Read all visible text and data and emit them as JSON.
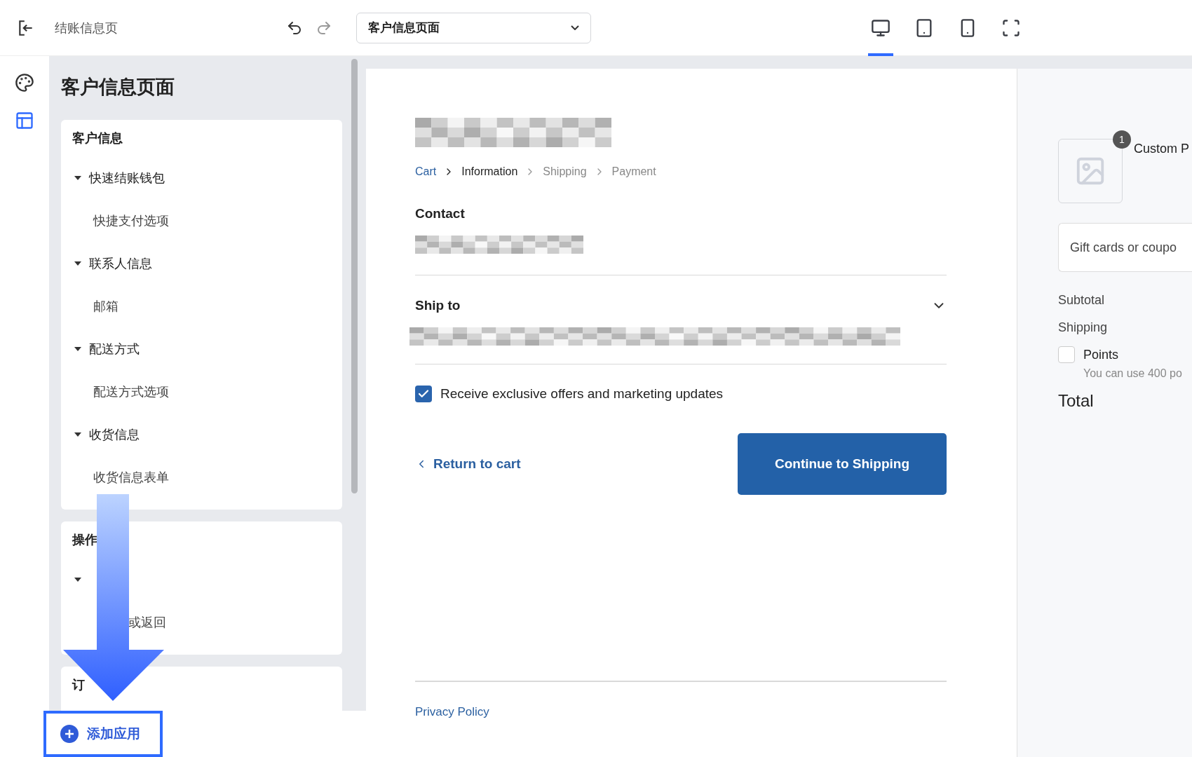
{
  "toolbar": {
    "page_title": "结账信息页",
    "page_select": {
      "value": "客户信息页面"
    },
    "devices": [
      {
        "kind": "desktop",
        "selected": true
      },
      {
        "kind": "tablet",
        "selected": false
      },
      {
        "kind": "phone",
        "selected": false
      },
      {
        "kind": "fullscreen",
        "selected": false
      }
    ]
  },
  "rail": [
    {
      "kind": "theme",
      "selected": false
    },
    {
      "kind": "sections",
      "selected": true
    }
  ],
  "sidebar": {
    "title": "客户信息页面",
    "sections": [
      {
        "title": "客户信息",
        "items": [
          {
            "label": "快速结账钱包",
            "expanded": true,
            "children": [
              {
                "label": "快捷支付选项"
              }
            ]
          },
          {
            "label": "联系人信息",
            "expanded": true,
            "children": [
              {
                "label": "邮箱"
              }
            ]
          },
          {
            "label": "配送方式",
            "expanded": true,
            "children": [
              {
                "label": "配送方式选项"
              }
            ]
          },
          {
            "label": "收货信息",
            "expanded": true,
            "children": [
              {
                "label": "收货信息表单"
              }
            ]
          }
        ]
      },
      {
        "title": "操作",
        "items": [
          {
            "expanded": true,
            "children": [
              {
                "label": "或返回"
              }
            ]
          }
        ]
      },
      {
        "title": "订"
      }
    ],
    "add_app": "添加应用"
  },
  "preview": {
    "breadcrumb": [
      {
        "label": "Cart",
        "kind": "link"
      },
      {
        "label": "Information",
        "kind": "current"
      },
      {
        "label": "Shipping",
        "kind": "upcoming"
      },
      {
        "label": "Payment",
        "kind": "upcoming"
      }
    ],
    "contact_title": "Contact",
    "ship_to_title": "Ship to",
    "marketing": {
      "label": "Receive exclusive offers and marketing updates",
      "checked": true
    },
    "return_link": "Return to cart",
    "continue_button": "Continue to Shipping",
    "privacy_link": "Privacy Policy"
  },
  "summary": {
    "product": {
      "name": "Custom P",
      "quantity": "1"
    },
    "gift": {
      "placeholder": "Gift cards or coupo"
    },
    "subtotal": "Subtotal",
    "shipping": "Shipping",
    "points": {
      "label": "Points",
      "checked": false,
      "hint": "You can use 400 po"
    },
    "total": "Total"
  }
}
